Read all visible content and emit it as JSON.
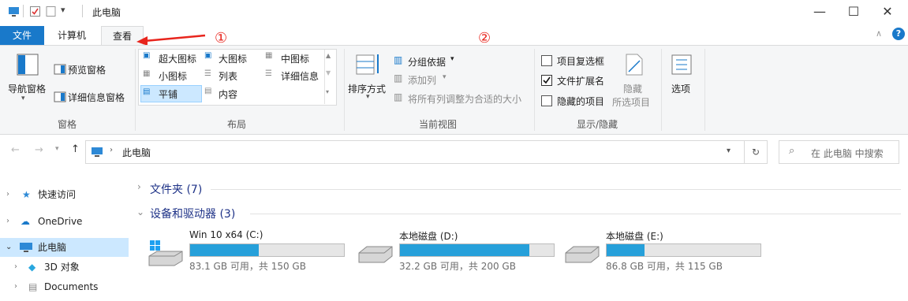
{
  "window": {
    "title": "此电脑",
    "minimize": "—",
    "maximize": "☐",
    "close": "✕"
  },
  "tabs": {
    "file": "文件",
    "computer": "计算机",
    "view": "查看"
  },
  "annotations": {
    "marker1": "①",
    "marker2": "②",
    "color": "#e8251d"
  },
  "ribbon": {
    "panes": {
      "nav_pane": "导航窗格",
      "preview_pane": "预览窗格",
      "details_pane": "详细信息窗格",
      "label": "窗格"
    },
    "layout": {
      "extra_large": "超大图标",
      "large": "大图标",
      "medium": "中图标",
      "small": "小图标",
      "list": "列表",
      "details": "详细信息",
      "tiles": "平铺",
      "content": "内容",
      "label": "布局"
    },
    "current_view": {
      "sort_by": "排序方式",
      "group_by": "分组依据",
      "add_columns": "添加列",
      "size_all_columns": "将所有列调整为合适的大小",
      "label": "当前视图"
    },
    "show_hide": {
      "item_checkboxes": "项目复选框",
      "item_checkboxes_checked": false,
      "file_extensions": "文件扩展名",
      "file_extensions_checked": true,
      "hidden_items": "隐藏的项目",
      "hidden_items_checked": false,
      "hide_selected_line1": "隐藏",
      "hide_selected_line2": "所选项目",
      "label": "显示/隐藏"
    },
    "options": "选项"
  },
  "address": {
    "path": "此电脑",
    "search_placeholder": "在 此电脑 中搜索"
  },
  "nav": {
    "items": [
      {
        "label": "快速访问"
      },
      {
        "label": "OneDrive"
      },
      {
        "label": "此电脑"
      },
      {
        "label": "3D 对象"
      },
      {
        "label": "Documents"
      }
    ]
  },
  "main": {
    "folders_section": "文件夹 (7)",
    "devices_section": "设备和驱动器 (3)",
    "drives": [
      {
        "name": "Win 10 x64 (C:)",
        "info": "83.1 GB 可用，共 150 GB",
        "used_fraction": 0.446
      },
      {
        "name": "本地磁盘 (D:)",
        "info": "32.2 GB 可用，共 200 GB",
        "used_fraction": 0.839
      },
      {
        "name": "本地磁盘 (E:)",
        "info": "86.8 GB 可用，共 115 GB",
        "used_fraction": 0.245
      }
    ]
  },
  "colors": {
    "accent": "#1979ca",
    "selection": "#cce8ff",
    "drive_bar": "#26a0da"
  }
}
